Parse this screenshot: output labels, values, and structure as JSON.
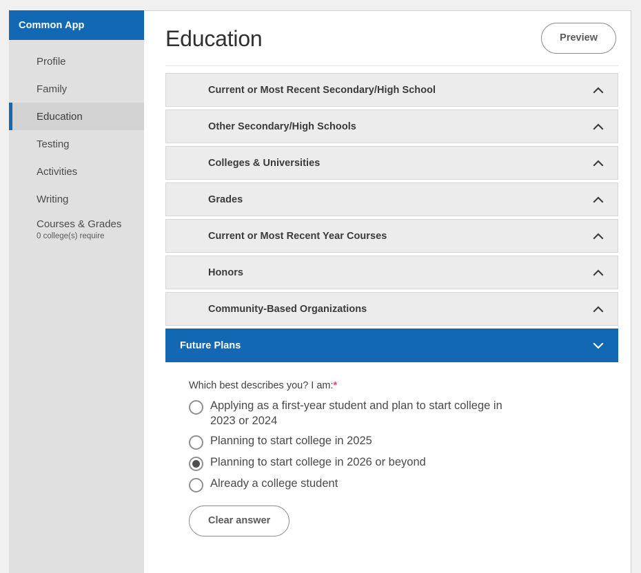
{
  "sidebar": {
    "brand": "Common App",
    "items": [
      {
        "label": "Profile",
        "sub": "",
        "active": false
      },
      {
        "label": "Family",
        "sub": "",
        "active": false
      },
      {
        "label": "Education",
        "sub": "",
        "active": true
      },
      {
        "label": "Testing",
        "sub": "",
        "active": false
      },
      {
        "label": "Activities",
        "sub": "",
        "active": false
      },
      {
        "label": "Writing",
        "sub": "",
        "active": false
      },
      {
        "label": "Courses & Grades",
        "sub": "0 college(s) require",
        "active": false
      }
    ]
  },
  "header": {
    "title": "Education",
    "preview_label": "Preview"
  },
  "accordion": [
    {
      "title": "Current or Most Recent Secondary/High School",
      "open": false,
      "icon": "chevron-up-icon"
    },
    {
      "title": "Other Secondary/High Schools",
      "open": false,
      "icon": "chevron-up-icon"
    },
    {
      "title": "Colleges & Universities",
      "open": false,
      "icon": "chevron-up-icon"
    },
    {
      "title": "Grades",
      "open": false,
      "icon": "chevron-up-icon"
    },
    {
      "title": "Current or Most Recent Year Courses",
      "open": false,
      "icon": "chevron-up-icon"
    },
    {
      "title": "Honors",
      "open": false,
      "icon": "chevron-up-icon"
    },
    {
      "title": "Community-Based Organizations",
      "open": false,
      "icon": "chevron-up-icon"
    },
    {
      "title": "Future Plans",
      "open": true,
      "icon": "chevron-down-icon"
    }
  ],
  "future_plans": {
    "question": "Which best describes you? I am:",
    "required_marker": "*",
    "options": [
      {
        "label": "Applying as a first-year student and plan to start college in 2023 or 2024",
        "selected": false
      },
      {
        "label": "Planning to start college in 2025",
        "selected": false
      },
      {
        "label": "Planning to start college in 2026 or beyond",
        "selected": true
      },
      {
        "label": "Already a college student",
        "selected": false
      }
    ],
    "clear_label": "Clear answer"
  },
  "colors": {
    "brand_blue": "#1268b3",
    "sidebar_bg": "#e0e0e0",
    "active_nav_bg": "#d2d2d2",
    "accordion_bg": "#ececec",
    "required_red": "#e8456c"
  }
}
